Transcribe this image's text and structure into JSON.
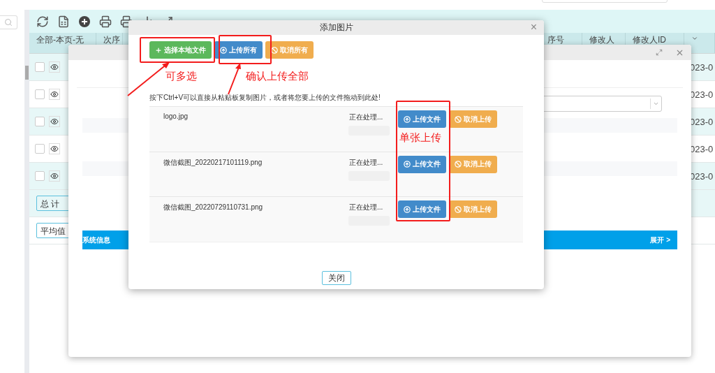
{
  "table": {
    "columns": [
      {
        "label": "全部-本页-无"
      },
      {
        "label": "次序"
      }
    ],
    "right_columns": [
      {
        "label": "序号"
      },
      {
        "label": "修改人"
      },
      {
        "label": "修改人ID"
      }
    ],
    "rows": [
      {
        "checked": false,
        "date": "023-0"
      },
      {
        "checked": false,
        "date": "023-0"
      },
      {
        "checked": false,
        "date": "023-0"
      },
      {
        "checked": false,
        "date": "023-0"
      },
      {
        "checked": false,
        "date": "023-0"
      }
    ],
    "total_label": "总 计",
    "average_label": "平均值"
  },
  "back_dialog": {
    "section_title": "系统信息",
    "expand": "展开 >"
  },
  "dialog": {
    "title": "添加图片",
    "close_symbol": "×",
    "buttons": [
      {
        "label": "选择本地文件",
        "kind": "add"
      },
      {
        "label": "上传所有",
        "kind": "upload"
      },
      {
        "label": "取消所有",
        "kind": "cancel"
      }
    ],
    "hint": "按下Ctrl+V可以直接从粘贴板复制图片，或者将您要上传的文件拖动到此处!",
    "files": [
      {
        "name": "logo.jpg",
        "status": "正在处理...",
        "level": 0,
        "upload": "上传文件",
        "cancel": "取消上传"
      },
      {
        "name": "微信截图_20220217101119.png",
        "status": "正在处理...",
        "level": 0,
        "upload": "上传文件",
        "cancel": "取消上传"
      },
      {
        "name": "微信截图_20220729110731.png",
        "status": "正在处理...",
        "level": 0,
        "upload": "上传文件",
        "cancel": "取消上传"
      }
    ],
    "close": "关闭"
  },
  "annotations": [
    {
      "text": "可多选"
    },
    {
      "text": "确认上传全部"
    },
    {
      "text": "单张上传"
    }
  ]
}
